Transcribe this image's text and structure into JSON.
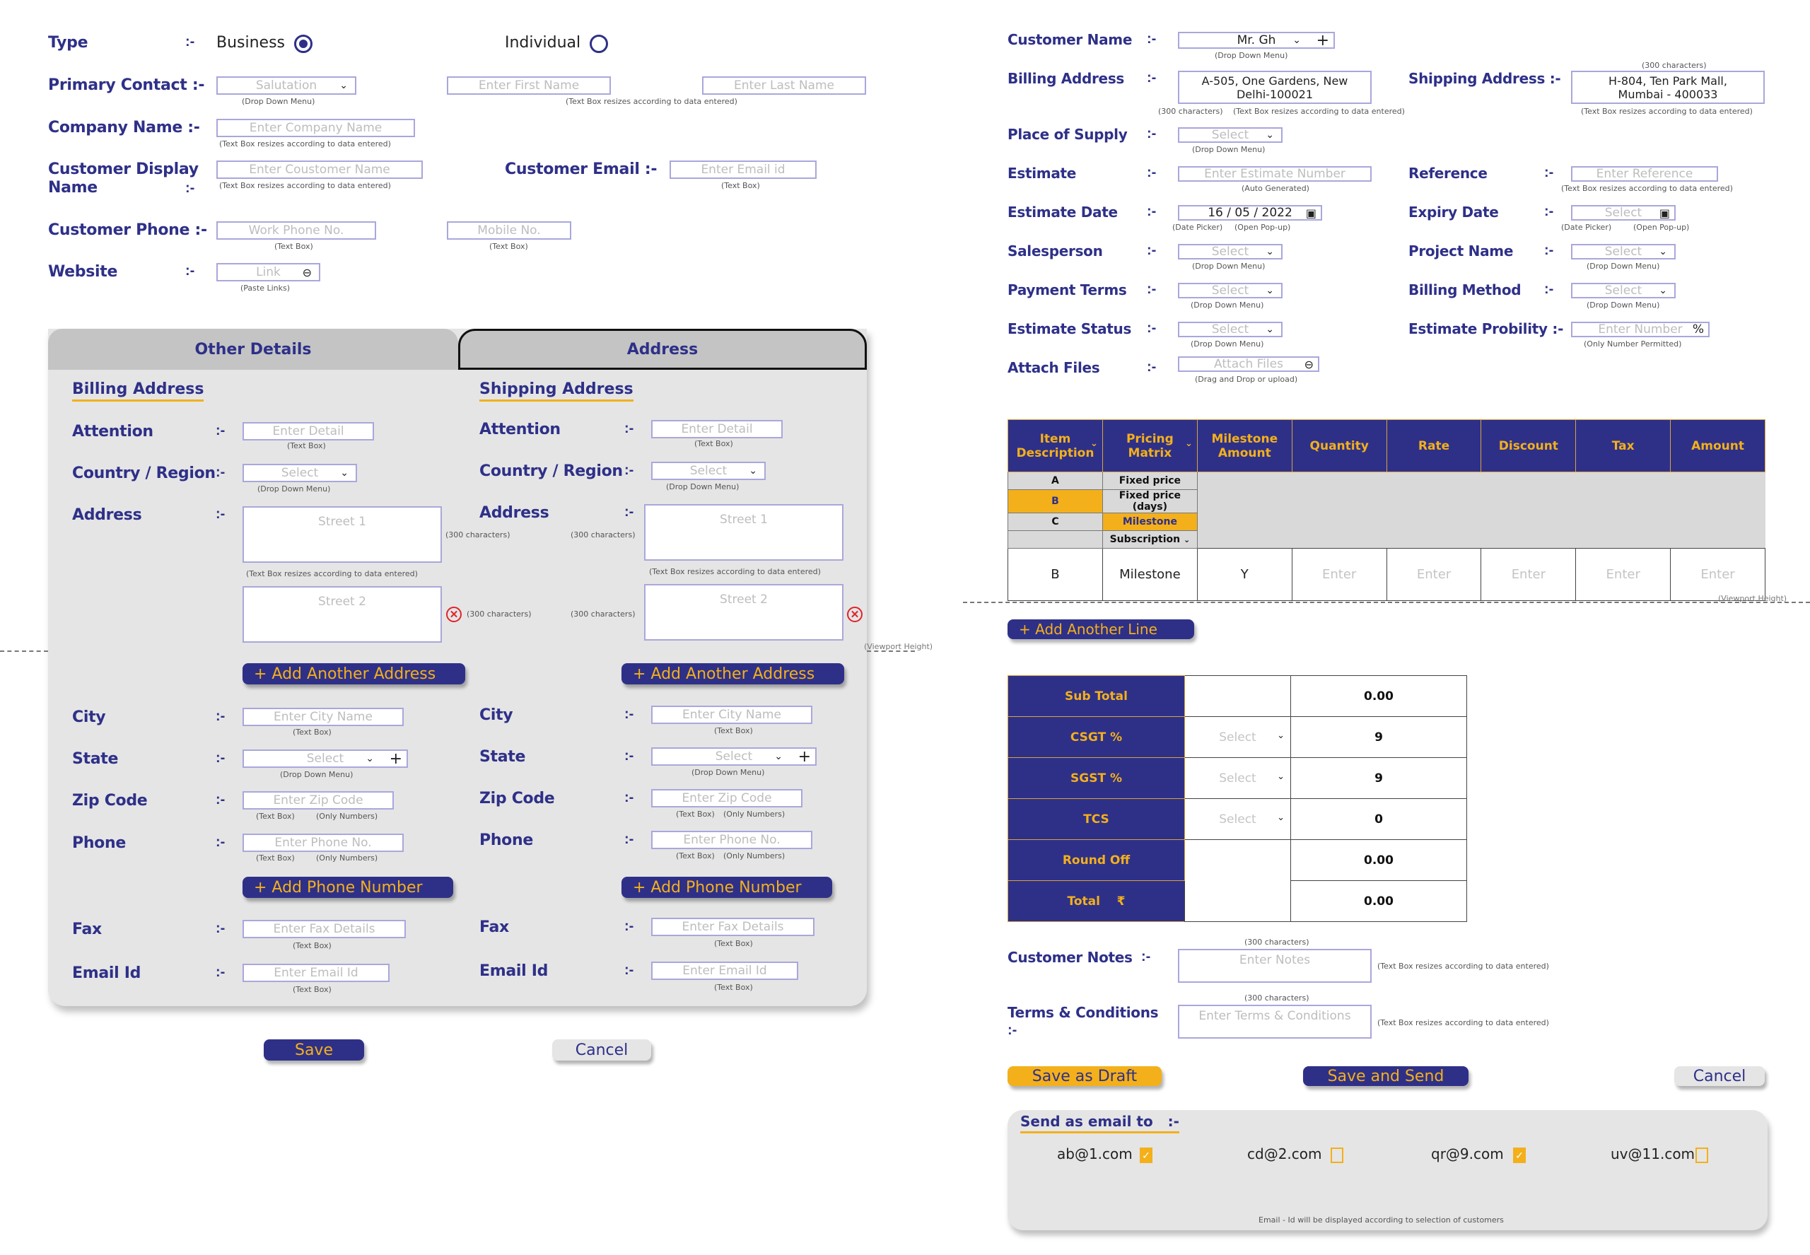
{
  "customer_form": {
    "type": {
      "label": "Type",
      "sep": ":-",
      "options": [
        {
          "label": "Business",
          "selected": true
        },
        {
          "label": "Individual",
          "selected": false
        }
      ]
    },
    "primary_contact": {
      "label": "Primary Contact :-",
      "salutation_placeholder": "Salutation",
      "salutation_hint": "(Drop Down Menu)",
      "first_name_placeholder": "Enter First Name",
      "last_name_placeholder": "Enter Last Name",
      "name_hint": "(Text Box resizes according to data entered)"
    },
    "company_name": {
      "label": "Company Name  :-",
      "placeholder": "Enter Company Name",
      "hint": "(Text Box resizes according to data entered)"
    },
    "display_name": {
      "label_line1": "Customer Display",
      "label_line2": "Name",
      "sep": ":-",
      "placeholder": "Enter Coustomer Name",
      "hint": "(Text Box resizes according to data entered)"
    },
    "customer_email": {
      "label": "Customer Email :-",
      "placeholder": "Enter Email id",
      "hint": "(Text Box)"
    },
    "customer_phone": {
      "label": "Customer Phone :-",
      "work_placeholder": "Work Phone No.",
      "mobile_placeholder": "Mobile No.",
      "hint": "(Text Box)"
    },
    "website": {
      "label": "Website",
      "sep": ":-",
      "placeholder": "Link",
      "hint": "(Paste Links)",
      "icon": "link-icon"
    }
  },
  "tabs": [
    {
      "label": "Other Details",
      "active": false
    },
    {
      "label": "Address",
      "active": true
    }
  ],
  "address": {
    "sep": ":-",
    "billing": {
      "title": "Billing Address",
      "attention": {
        "label": "Attention",
        "placeholder": "Enter Detail",
        "hint": "(Text Box)"
      },
      "country": {
        "label": "Country / Region",
        "placeholder": "Select",
        "hint": "(Drop Down Menu)"
      },
      "address": {
        "label": "Address",
        "street1": "Street 1",
        "street2": "Street 2",
        "chars": "(300 characters)",
        "hint": "(Text Box resizes according to data entered)"
      },
      "add_address": "+ Add Another Address",
      "city": {
        "label": "City",
        "placeholder": "Enter City Name",
        "hint": "(Text Box)"
      },
      "state": {
        "label": "State",
        "placeholder": "Select",
        "hint": "(Drop Down Menu)"
      },
      "zip": {
        "label": "Zip Code",
        "placeholder": "Enter Zip Code",
        "hint1": "(Text Box)",
        "hint2": "(Only Numbers)"
      },
      "phone": {
        "label": "Phone",
        "placeholder": "Enter Phone No.",
        "hint1": "(Text Box)",
        "hint2": "(Only Numbers)"
      },
      "add_phone": "+ Add Phone Number",
      "fax": {
        "label": "Fax",
        "placeholder": "Enter Fax Details",
        "hint": "(Text Box)"
      },
      "email": {
        "label": "Email Id",
        "placeholder": "Enter Email Id",
        "hint": "(Text Box)"
      }
    },
    "shipping": {
      "title": "Shipping Address",
      "attention": {
        "label": "Attention",
        "placeholder": "Enter Detail",
        "hint": "(Text Box)"
      },
      "country": {
        "label": "Country / Region",
        "placeholder": "Select",
        "hint": "(Drop Down Menu)"
      },
      "address": {
        "label": "Address",
        "street1": "Street 1",
        "street2": "Street 2",
        "chars": "(300 characters)",
        "hint": "(Text Box resizes according to data entered)"
      },
      "add_address": "+ Add Another Address",
      "city": {
        "label": "City",
        "placeholder": "Enter City Name",
        "hint": "(Text Box)"
      },
      "state": {
        "label": "State",
        "placeholder": "Select",
        "hint": "(Drop Down Menu)"
      },
      "zip": {
        "label": "Zip Code",
        "placeholder": "Enter Zip Code",
        "hint1": "(Text Box)",
        "hint2": "(Only Numbers)"
      },
      "phone": {
        "label": "Phone",
        "placeholder": "Enter Phone No.",
        "hint1": "(Text Box)",
        "hint2": "(Only Numbers)"
      },
      "add_phone": "+ Add Phone Number",
      "fax": {
        "label": "Fax",
        "placeholder": "Enter Fax Details",
        "hint": "(Text Box)"
      },
      "email": {
        "label": "Email Id",
        "placeholder": "Enter Email Id",
        "hint": "(Text Box)"
      }
    },
    "viewport_note": "(Viewport Height)"
  },
  "left_actions": {
    "save": "Save",
    "cancel": "Cancel"
  },
  "estimate": {
    "sep": ":-",
    "customer_name": {
      "label": "Customer Name",
      "value": "Mr. Gh",
      "hint": "(Drop Down Menu)"
    },
    "billing_address": {
      "label": "Billing Address",
      "line1": "A-505, One Gardens, New",
      "line2": "Delhi-100021",
      "chars": "(300 characters)",
      "hint": "(Text Box resizes according to data entered)"
    },
    "shipping_address": {
      "label": "Shipping Address :-",
      "line1": "H-804, Ten Park Mall,",
      "line2": "Mumbai - 400033",
      "chars": "(300 characters)",
      "hint": "(Text Box resizes according to data entered)"
    },
    "place_of_supply": {
      "label": "Place of Supply",
      "placeholder": "Select",
      "hint": "(Drop Down Menu)"
    },
    "estimate_no": {
      "label": "Estimate",
      "placeholder": "Enter Estimate Number",
      "hint": "(Auto Generated)"
    },
    "reference": {
      "label": "Reference",
      "placeholder": "Enter Reference",
      "hint": "(Text Box resizes according to data entered)"
    },
    "estimate_date": {
      "label": "Estimate Date",
      "value": "16 / 05 / 2022",
      "hint1": "(Date Picker)",
      "hint2": "(Open Pop-up)"
    },
    "expiry_date": {
      "label": "Expiry Date",
      "placeholder": "Select",
      "hint1": "(Date Picker)",
      "hint2": "(Open Pop-up)"
    },
    "salesperson": {
      "label": "Salesperson",
      "placeholder": "Select",
      "hint": "(Drop Down Menu)"
    },
    "project_name": {
      "label": "Project Name",
      "placeholder": "Select",
      "hint": "(Drop Down Menu)"
    },
    "payment_terms": {
      "label": "Payment Terms",
      "placeholder": "Select",
      "hint": "(Drop Down Menu)"
    },
    "billing_method": {
      "label": "Billing Method",
      "placeholder": "Select",
      "hint": "(Drop Down Menu)"
    },
    "estimate_status": {
      "label": "Estimate Status",
      "placeholder": "Select",
      "hint": "(Drop Down Menu)"
    },
    "estimate_probability": {
      "label": "Estimate Probility :-",
      "placeholder": "Enter Number",
      "suffix": "%",
      "hint": "(Only Number Permitted)"
    },
    "attach_files": {
      "label": "Attach Files",
      "placeholder": "Attach Files",
      "hint": "(Drag and Drop or upload)"
    }
  },
  "items_table": {
    "headers": [
      "Item Description",
      "Pricing Matrix",
      "Milestone Amount",
      "Quantity",
      "Rate",
      "Discount",
      "Tax",
      "Amount"
    ],
    "item_options": [
      "A",
      "B",
      "C",
      ""
    ],
    "item_selected": "B",
    "pricing_options": [
      "Fixed price",
      "Fixed price (days)",
      "Milestone",
      "Subscription"
    ],
    "pricing_selected": "Milestone",
    "row": {
      "item": "B",
      "pricing": "Milestone",
      "milestone": "Y",
      "quantity": "Enter",
      "rate": "Enter",
      "discount": "Enter",
      "tax": "Enter",
      "amount": "Enter"
    },
    "viewport_note": "(Viewport Height)",
    "add_line": "+ Add Another Line"
  },
  "totals": [
    {
      "label": "Sub Total",
      "select": "",
      "value": "0.00"
    },
    {
      "label": "CSGT %",
      "select": "Select",
      "value": "9"
    },
    {
      "label": "SGST %",
      "select": "Select",
      "value": "9"
    },
    {
      "label": "TCS",
      "select": "Select",
      "value": "0"
    },
    {
      "label": "Round Off",
      "select": "",
      "value": "0.00"
    },
    {
      "label": "Total",
      "select": "",
      "value": "0.00",
      "currency": "₹"
    }
  ],
  "notes": {
    "customer_notes": {
      "label": "Customer Notes",
      "sep": ":-",
      "placeholder": "Enter Notes",
      "chars": "(300 characters)",
      "hint": "(Text Box resizes according to data entered)"
    },
    "terms": {
      "label": "Terms & Conditions",
      "sep": ":-",
      "placeholder": "Enter Terms & Conditions",
      "chars": "(300 characters)",
      "hint": "(Text Box resizes according to data entered)"
    }
  },
  "right_actions": {
    "draft": "Save as Draft",
    "send": "Save and Send",
    "cancel": "Cancel"
  },
  "send_email": {
    "title": "Send as email to",
    "sep": ":-",
    "recipients": [
      {
        "email": "ab@1.com",
        "checked": true
      },
      {
        "email": "cd@2.com",
        "checked": false
      },
      {
        "email": "qr@9.com",
        "checked": true
      },
      {
        "email": "uv@11.com",
        "checked": false
      }
    ],
    "footnote": "Email - Id will be displayed according to selection of customers"
  },
  "colors": {
    "primary": "#2e3088",
    "accent": "#f3b01b",
    "panel": "#e5e5e5",
    "danger": "#e0242b"
  }
}
